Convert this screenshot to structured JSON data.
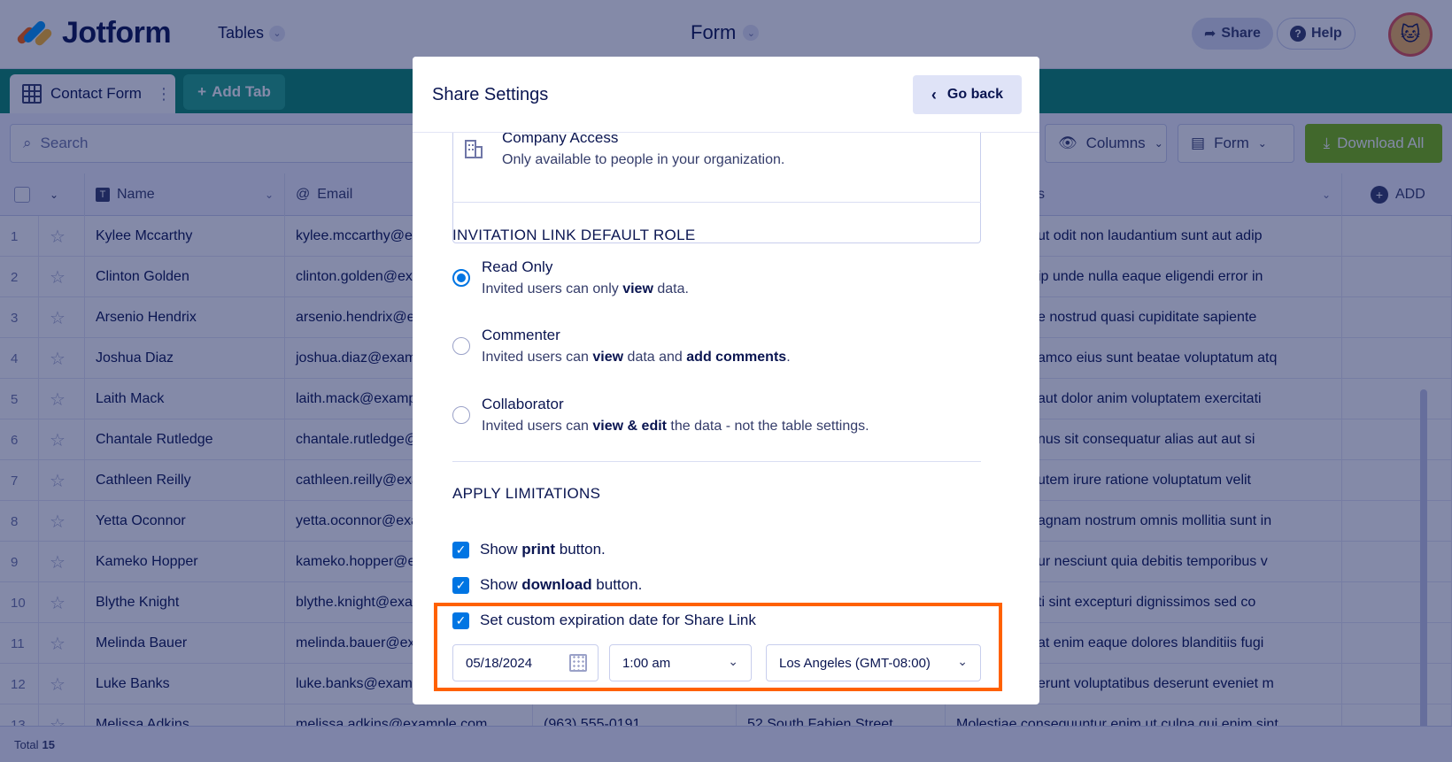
{
  "app": {
    "logo_text": "Jotform",
    "brand_color": "#0a8b6d",
    "accent_color": "#0075e3",
    "highlight_color": "#ff6100"
  },
  "header": {
    "tables_label": "Tables",
    "form_title": "Form",
    "share_label": "Share",
    "help_label": "Help"
  },
  "tabs": {
    "contact_form": "Contact Form",
    "add_tab": "Add Tab"
  },
  "toolbar": {
    "search_placeholder": "Search",
    "columns_label": "Columns",
    "form_label": "Form",
    "download_all_label": "Download All"
  },
  "table": {
    "columns": [
      "Name",
      "Email",
      "s",
      "ADD"
    ],
    "rows": [
      {
        "num": "1",
        "name": "Kylee Mccarthy",
        "email": "kylee.mccarthy@e",
        "notes": "ut odit non laudantium sunt aut adip"
      },
      {
        "num": "2",
        "name": "Clinton Golden",
        "email": "clinton.golden@ex",
        "notes": "ip unde nulla eaque eligendi error in"
      },
      {
        "num": "3",
        "name": "Arsenio Hendrix",
        "email": "arsenio.hendrix@e",
        "notes": "e nostrud quasi cupiditate sapiente"
      },
      {
        "num": "4",
        "name": "Joshua Diaz",
        "email": "joshua.diaz@exam",
        "notes": "amco eius sunt beatae voluptatum atq"
      },
      {
        "num": "5",
        "name": "Laith Mack",
        "email": "laith.mack@examp",
        "notes": "aut dolor anim voluptatem exercitati"
      },
      {
        "num": "6",
        "name": "Chantale Rutledge",
        "email": "chantale.rutledge@",
        "notes": "nus sit consequatur alias aut aut si"
      },
      {
        "num": "7",
        "name": "Cathleen Reilly",
        "email": "cathleen.reilly@exa",
        "notes": "utem irure ratione voluptatum velit"
      },
      {
        "num": "8",
        "name": "Yetta Oconnor",
        "email": "yetta.oconnor@exa",
        "notes": "agnam nostrum omnis mollitia sunt in"
      },
      {
        "num": "9",
        "name": "Kameko Hopper",
        "email": "kameko.hopper@e",
        "notes": "ur nesciunt quia debitis temporibus v"
      },
      {
        "num": "10",
        "name": "Blythe Knight",
        "email": "blythe.knight@exa",
        "notes": "ti sint excepturi dignissimos sed co"
      },
      {
        "num": "11",
        "name": "Melinda Bauer",
        "email": "melinda.bauer@ex",
        "notes": "at enim eaque dolores blanditiis fugi"
      },
      {
        "num": "12",
        "name": "Luke Banks",
        "email": "luke.banks@examp",
        "notes": "erunt voluptatibus deserunt eveniet m"
      },
      {
        "num": "13",
        "name": "Melissa Adkins",
        "email": "melissa.adkins@example.com",
        "phone": "(963) 555-0191",
        "address": "52 South Fabien Street",
        "notes": "Molestiae consequuntur enim ut culpa qui enim sint"
      }
    ],
    "footer_label": "Total",
    "footer_count": "15"
  },
  "modal": {
    "title": "Share Settings",
    "go_back_label": "Go back",
    "company_access_title": "Company Access",
    "company_access_desc": "Only available to people in your organization.",
    "default_role_title": "INVITATION LINK DEFAULT ROLE",
    "roles": [
      {
        "title": "Read Only",
        "desc_parts": [
          "Invited users can only ",
          "view",
          " data."
        ],
        "selected": true
      },
      {
        "title": "Commenter",
        "desc_parts": [
          "Invited users can ",
          "view",
          " data and ",
          "add comments",
          "."
        ],
        "selected": false
      },
      {
        "title": "Collaborator",
        "desc_parts": [
          "Invited users can ",
          "view & edit",
          " the data - not the table settings."
        ],
        "selected": false
      }
    ],
    "limitations_title": "APPLY LIMITATIONS",
    "limitations": [
      {
        "parts": [
          "Show ",
          "print",
          " button."
        ],
        "checked": true
      },
      {
        "parts": [
          "Show ",
          "download",
          " button."
        ],
        "checked": true
      },
      {
        "parts": [
          "Set custom expiration date for Share Link"
        ],
        "checked": true
      }
    ],
    "expiration": {
      "date": "05/18/2024",
      "time": "1:00 am",
      "timezone": "Los Angeles (GMT-08:00)"
    }
  }
}
